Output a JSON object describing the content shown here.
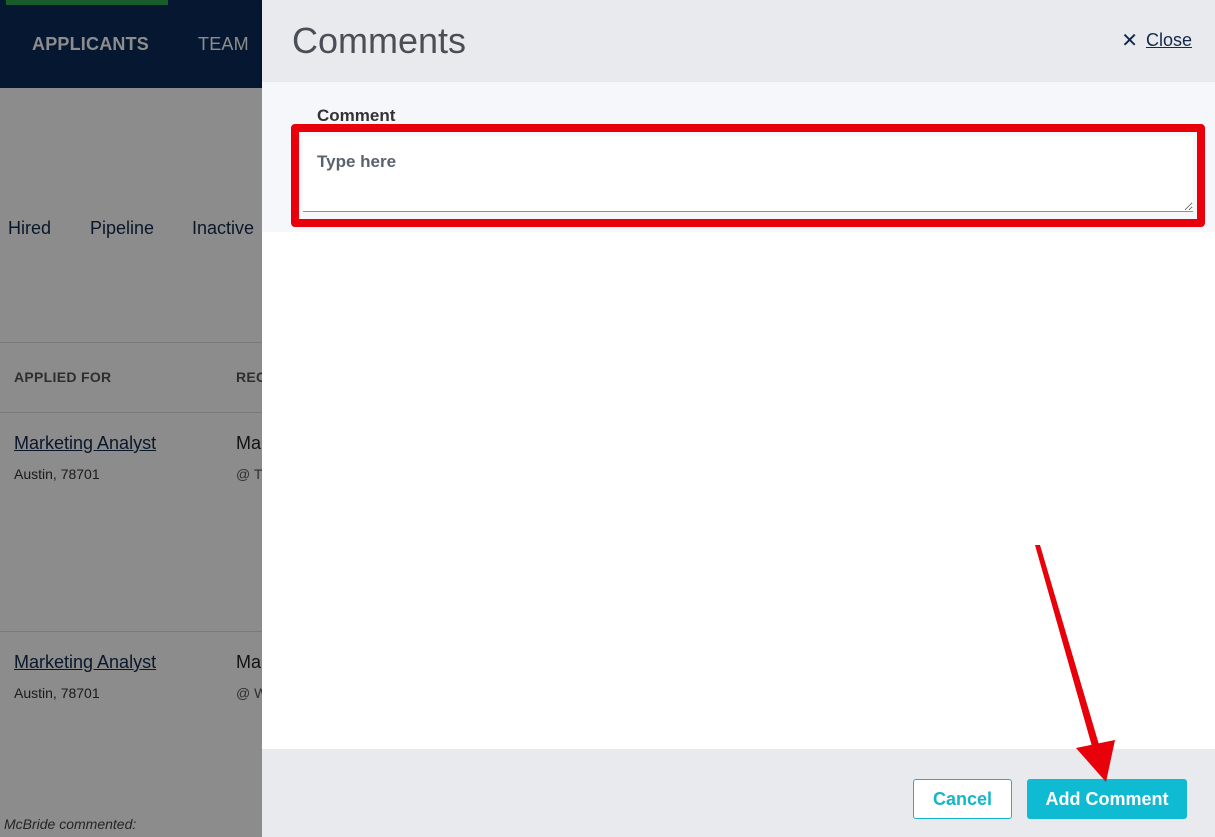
{
  "background": {
    "nav": {
      "applicants": "APPLICANTS",
      "team": "TEAM"
    },
    "tabs": [
      "Hired",
      "Pipeline",
      "Inactive"
    ],
    "table": {
      "headers": {
        "applied_for": "APPLIED FOR",
        "rec": "REC"
      },
      "rows": [
        {
          "job": "Marketing Analyst",
          "location": "Austin, 78701",
          "col2_main": "Ma",
          "col2_sub": "@ T"
        },
        {
          "job": "Marketing Analyst",
          "location": "Austin, 78701",
          "col2_main": "Ma",
          "col2_sub": "@ W"
        }
      ]
    },
    "commented": "McBride commented:"
  },
  "drawer": {
    "title": "Comments",
    "close_label": "Close",
    "close_icon": "close-icon",
    "field_label": "Comment",
    "comment_placeholder": "Type here",
    "comment_value": "",
    "cancel_label": "Cancel",
    "add_label": "Add Comment"
  },
  "colors": {
    "nav_bg": "#0b2a5a",
    "accent_green": "#2fa84f",
    "highlight_red": "#e8000a",
    "primary_button": "#0fbad3"
  }
}
